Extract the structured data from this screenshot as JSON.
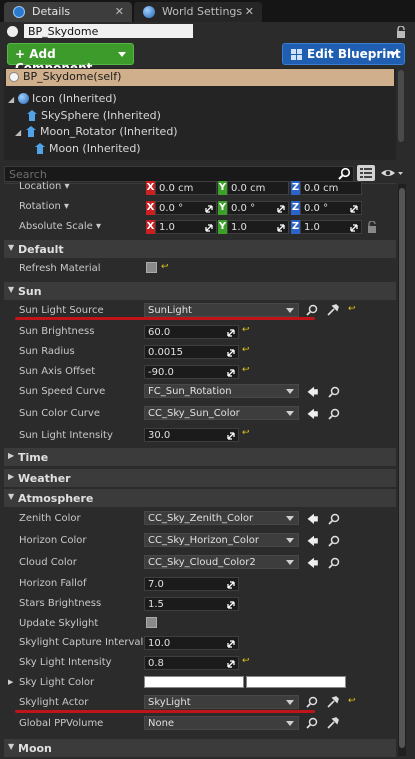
{
  "tabs": [
    {
      "label": "Details",
      "close": "✕"
    },
    {
      "label": "World Settings",
      "close": "✕"
    }
  ],
  "actor_name": "BP_Skydome",
  "buttons": {
    "add_component": "+ Add Component",
    "edit_blueprint": "Edit Blueprint"
  },
  "tree": [
    {
      "label": "BP_Skydome(self)"
    },
    {
      "label": "Icon (Inherited)"
    },
    {
      "label": "SkySphere (Inherited)"
    },
    {
      "label": "Moon_Rotator (Inherited)"
    },
    {
      "label": "Moon (Inherited)"
    }
  ],
  "search_placeholder": "Search",
  "transform": {
    "location": {
      "label": "Location",
      "x": "0.0 cm",
      "y": "0.0 cm",
      "z": "0.0 cm"
    },
    "rotation": {
      "label": "Rotation",
      "x": "0.0 °",
      "y": "0.0 °",
      "z": "0.0 °"
    },
    "scale": {
      "label": "Absolute Scale",
      "x": "1.0",
      "y": "1.0",
      "z": "1.0"
    }
  },
  "axis_labels": {
    "x": "X",
    "y": "Y",
    "z": "Z"
  },
  "sections": {
    "default": "Default",
    "sun": "Sun",
    "time": "Time",
    "weather": "Weather",
    "atmosphere": "Atmosphere",
    "moon": "Moon"
  },
  "default_props": {
    "refresh_material": "Refresh Material"
  },
  "sun_props": [
    {
      "label": "Sun Light Source",
      "value": "SunLight"
    },
    {
      "label": "Sun Brightness",
      "value": "60.0"
    },
    {
      "label": "Sun Radius",
      "value": "0.0015"
    },
    {
      "label": "Sun Axis Offset",
      "value": "-90.0"
    },
    {
      "label": "Sun Speed Curve",
      "value": "FC_Sun_Rotation"
    },
    {
      "label": "Sun Color Curve",
      "value": "CC_Sky_Sun_Color"
    },
    {
      "label": "Sun Light Intensity",
      "value": "30.0"
    }
  ],
  "atmosphere_props": [
    {
      "label": "Zenith Color",
      "value": "CC_Sky_Zenith_Color"
    },
    {
      "label": "Horizon Color",
      "value": "CC_Sky_Horizon_Color"
    },
    {
      "label": "Cloud Color",
      "value": "CC_Sky_Cloud_Color2"
    },
    {
      "label": "Horizon Fallof",
      "value": "7.0"
    },
    {
      "label": "Stars Brightness",
      "value": "1.5"
    },
    {
      "label": "Update Skylight",
      "value": ""
    },
    {
      "label": "Skylight Capture Interval",
      "value": "10.0"
    },
    {
      "label": "Sky Light Intensity",
      "value": "0.8"
    },
    {
      "label": "Sky Light Color",
      "value": ""
    },
    {
      "label": "Skylight Actor",
      "value": "SkyLight"
    },
    {
      "label": "Global PPVolume",
      "value": "None"
    }
  ],
  "colors": {
    "accent_green": "#3d9b2b",
    "accent_blue": "#1f5eb0",
    "highlight_line": "#c0141b",
    "selection": "#d0b08c"
  },
  "icons": [
    "details-icon",
    "world-icon",
    "lock-icon",
    "search-icon",
    "grid-view-icon",
    "eye-icon",
    "browse-icon",
    "use-selected-icon",
    "picker-icon",
    "reset-icon"
  ]
}
